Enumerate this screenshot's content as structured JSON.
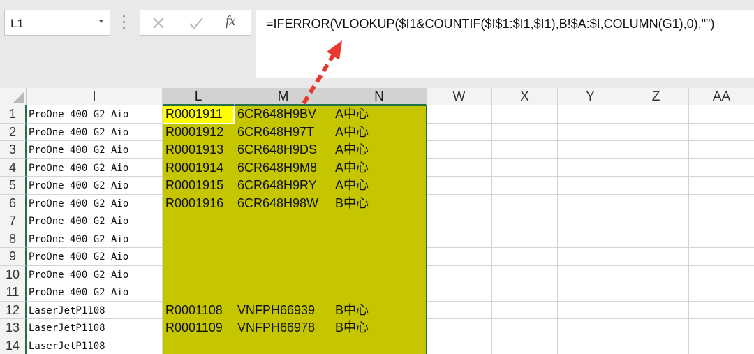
{
  "name_box": {
    "value": "L1"
  },
  "formula_bar": {
    "fx_label": "fx",
    "formula": "=IFERROR(VLOOKUP($I1&COUNTIF($I$1:$I1,$I1),B!$A:$I,COLUMN(G1),0),\"\")"
  },
  "columns": [
    "I",
    "L",
    "M",
    "N",
    "W",
    "X",
    "Y",
    "Z",
    "AA"
  ],
  "rows": [
    {
      "num": "1",
      "i": "ProOne 400 G2 Aio",
      "l": "R0001911",
      "m": "6CR648H9BV",
      "n": "A中心"
    },
    {
      "num": "2",
      "i": "ProOne 400 G2 Aio",
      "l": "R0001912",
      "m": "6CR648H97T",
      "n": "A中心"
    },
    {
      "num": "3",
      "i": "ProOne 400 G2 Aio",
      "l": "R0001913",
      "m": "6CR648H9DS",
      "n": "A中心"
    },
    {
      "num": "4",
      "i": "ProOne 400 G2 Aio",
      "l": "R0001914",
      "m": "6CR648H9M8",
      "n": "A中心"
    },
    {
      "num": "5",
      "i": "ProOne 400 G2 Aio",
      "l": "R0001915",
      "m": "6CR648H9RY",
      "n": "A中心"
    },
    {
      "num": "6",
      "i": "ProOne 400 G2 Aio",
      "l": "R0001916",
      "m": "6CR648H98W",
      "n": "B中心"
    },
    {
      "num": "7",
      "i": "ProOne 400 G2 Aio",
      "l": "",
      "m": "",
      "n": ""
    },
    {
      "num": "8",
      "i": "ProOne 400 G2 Aio",
      "l": "",
      "m": "",
      "n": ""
    },
    {
      "num": "9",
      "i": "ProOne 400 G2 Aio",
      "l": "",
      "m": "",
      "n": ""
    },
    {
      "num": "10",
      "i": "ProOne 400 G2 Aio",
      "l": "",
      "m": "",
      "n": ""
    },
    {
      "num": "11",
      "i": "ProOne 400 G2 Aio",
      "l": "",
      "m": "",
      "n": ""
    },
    {
      "num": "12",
      "i": "LaserJetP1108",
      "l": "R0001108",
      "m": "VNFPH66939",
      "n": "B中心"
    },
    {
      "num": "13",
      "i": "LaserJetP1108",
      "l": "R0001109",
      "m": "VNFPH66978",
      "n": "B中心"
    },
    {
      "num": "14",
      "i": "LaserJetP1108",
      "l": "",
      "m": "",
      "n": ""
    }
  ],
  "colors": {
    "highlight_green": "#c6c600",
    "active_cell": "#ffff00",
    "excel_green": "#217346",
    "arrow": "#e8392f"
  }
}
